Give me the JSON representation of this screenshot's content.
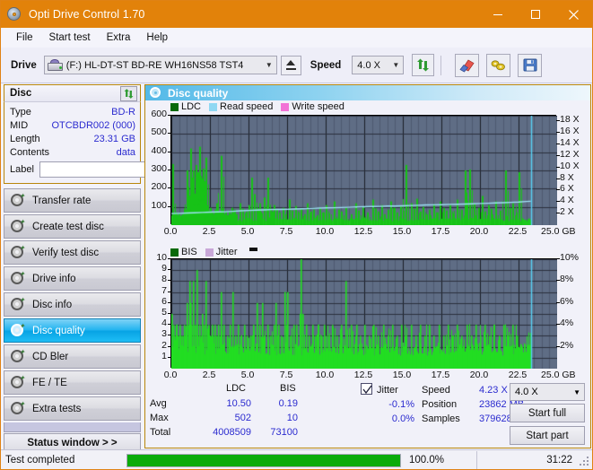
{
  "window": {
    "title": "Opti Drive Control 1.70",
    "icon": "disc-icon",
    "minimize": "─",
    "maximize": "□",
    "close": "✕"
  },
  "menubar": {
    "items": [
      "File",
      "Start test",
      "Extra",
      "Help"
    ]
  },
  "toolbar": {
    "drive_label": "Drive",
    "drive_value": "(F:)  HL-DT-ST BD-RE  WH16NS58 TST4",
    "eject_icon": "eject-icon",
    "speed_label": "Speed",
    "speed_value": "4.0 X",
    "refresh_icon": "refresh-icon",
    "erase_icon": "eraser-icon",
    "tools_icon": "tools-icon",
    "save_icon": "save-icon",
    "chevron": "⌄"
  },
  "disc_panel": {
    "title": "Disc",
    "refresh_icon": "refresh-icon",
    "rows": [
      {
        "label": "Type",
        "value": "BD-R"
      },
      {
        "label": "MID",
        "value": "OTCBDR002 (000)"
      },
      {
        "label": "Length",
        "value": "23.31 GB"
      },
      {
        "label": "Contents",
        "value": "data"
      }
    ],
    "label_field_label": "Label",
    "label_field_value": "",
    "label_button_icon": "disc-icon"
  },
  "nav": {
    "items": [
      {
        "label": "Transfer rate",
        "icon": "disc-icon",
        "selected": false
      },
      {
        "label": "Create test disc",
        "icon": "disc-icon",
        "selected": false
      },
      {
        "label": "Verify test disc",
        "icon": "disc-icon",
        "selected": false
      },
      {
        "label": "Drive info",
        "icon": "disc-icon",
        "selected": false
      },
      {
        "label": "Disc info",
        "icon": "disc-icon",
        "selected": false
      },
      {
        "label": "Disc quality",
        "icon": "disc-icon",
        "selected": true
      },
      {
        "label": "CD Bler",
        "icon": "disc-icon",
        "selected": false
      },
      {
        "label": "FE / TE",
        "icon": "disc-icon",
        "selected": false
      },
      {
        "label": "Extra tests",
        "icon": "disc-icon",
        "selected": false
      }
    ],
    "status_window_button": "Status window > >"
  },
  "content": {
    "header_title": "Disc quality",
    "header_icon": "disc-icon"
  },
  "stats": {
    "col_ldc": "LDC",
    "col_bis": "BIS",
    "rows": [
      {
        "label": "Avg",
        "ldc": "10.50",
        "bis": "0.19"
      },
      {
        "label": "Max",
        "ldc": "502",
        "bis": "10"
      },
      {
        "label": "Total",
        "ldc": "4008509",
        "bis": "73100"
      }
    ],
    "jitter_checkbox_label": "Jitter",
    "jitter_checked": true,
    "jitter_neg": "-0.1%",
    "jitter_pos": "0.0%",
    "speed_label": "Speed",
    "speed_value": "4.23 X",
    "position_label": "Position",
    "position_value": "23862 MB",
    "samples_label": "Samples",
    "samples_value": "379628",
    "speed_select_value": "4.0 X",
    "speed_select_chevron": "⌄",
    "start_full_button": "Start full",
    "start_part_button": "Start part"
  },
  "statusbar": {
    "text": "Test completed",
    "percent": "100.0%",
    "percent_value": 100,
    "time": "31:22"
  },
  "colors": {
    "title_bar": "#e2820a",
    "accent_border": "#b8860b",
    "plot_bg": "#5f6d85",
    "ldc_green": "#16a016",
    "bis_green": "#22dd22",
    "read_speed": "#7fd4f0",
    "write_speed": "#f07ad8",
    "jitter": "#c9a8d8",
    "selected_nav": "#0aa3e4",
    "progress_green": "#0aab0a",
    "value_blue": "#2b2bcf"
  },
  "chart_data": [
    {
      "type": "line",
      "id": "ldc-chart",
      "title": "Disc quality",
      "xlabel": "GB",
      "ylabel": "LDC",
      "legend": [
        {
          "name": "LDC",
          "color": "#0a6a0a"
        },
        {
          "name": "Read speed",
          "color": "#7fd4f0"
        },
        {
          "name": "Write speed",
          "color": "#f07ad8"
        }
      ],
      "legend_position": "top-left",
      "grid": true,
      "xlim": [
        0.0,
        25.0
      ],
      "xticks": [
        "0.0",
        "2.5",
        "5.0",
        "7.5",
        "10.0",
        "12.5",
        "15.0",
        "17.5",
        "20.0",
        "22.5",
        "25.0 GB"
      ],
      "ylim": [
        0,
        600
      ],
      "yticks": [
        100,
        200,
        300,
        400,
        500,
        600
      ],
      "y2lim": [
        0,
        19
      ],
      "y2ticks": [
        "2 X",
        "4 X",
        "6 X",
        "8 X",
        "10 X",
        "12 X",
        "14 X",
        "16 X",
        "18 X"
      ],
      "series": [
        {
          "name": "LDC",
          "color": "#16a016",
          "type": "impulse",
          "x": [
            0.05,
            0.12,
            0.2,
            0.3,
            0.38,
            0.45,
            0.55,
            0.62,
            0.7,
            0.8,
            0.9,
            1.0,
            1.05,
            1.12,
            1.2,
            1.3,
            1.35,
            1.42,
            1.5,
            1.55,
            1.6,
            1.68,
            1.72,
            1.8,
            1.85,
            1.9,
            1.95,
            2.0,
            2.05,
            2.1,
            2.15,
            2.2,
            2.3,
            2.35,
            2.4,
            2.5,
            2.6,
            2.7,
            2.8,
            2.9,
            3.0,
            3.1,
            3.2,
            3.3,
            3.4,
            3.5,
            3.6,
            3.7,
            3.8,
            3.9,
            3.95,
            4.05,
            4.2,
            4.4,
            4.6,
            4.8,
            5.0,
            5.2,
            5.35,
            5.5,
            5.6,
            5.7,
            5.8,
            6.0,
            6.2,
            6.4,
            6.5,
            6.6,
            6.8,
            7.0,
            7.2,
            7.4,
            7.6,
            7.8,
            8.0,
            8.2,
            8.4,
            8.6,
            8.8,
            9.0,
            9.2,
            9.4,
            9.6,
            9.8,
            10.0,
            10.2,
            10.5,
            10.8,
            11.0,
            11.3,
            11.6,
            11.9,
            12.1,
            12.4,
            12.7,
            13.0,
            13.2,
            13.4,
            13.6,
            13.8,
            14.0,
            14.2,
            14.4,
            14.6,
            14.8,
            15.0,
            15.2,
            15.5,
            15.7,
            15.9,
            16.1,
            16.3,
            16.5,
            16.7,
            17.0,
            17.2,
            17.4,
            17.6,
            17.8,
            18.0,
            18.2,
            18.5,
            18.8,
            19.0,
            19.3,
            19.6,
            19.9,
            20.1,
            20.3,
            20.5,
            20.7,
            21.0,
            21.3,
            21.6,
            21.9,
            22.1,
            22.3,
            22.5
          ],
          "y": [
            335,
            60,
            55,
            70,
            50,
            65,
            45,
            55,
            60,
            80,
            85,
            300,
            210,
            150,
            420,
            190,
            260,
            300,
            170,
            330,
            240,
            290,
            140,
            430,
            270,
            200,
            255,
            190,
            310,
            240,
            160,
            370,
            90,
            110,
            80,
            95,
            70,
            60,
            85,
            120,
            55,
            70,
            380,
            90,
            60,
            75,
            55,
            80,
            60,
            95,
            70,
            85,
            60,
            120,
            90,
            75,
            110,
            260,
            170,
            95,
            80,
            120,
            65,
            150,
            260,
            90,
            75,
            110,
            85,
            70,
            95,
            60,
            140,
            80,
            105,
            70,
            90,
            60,
            120,
            75,
            85,
            55,
            95,
            70,
            110,
            65,
            130,
            85,
            75,
            95,
            60,
            120,
            80,
            100,
            70,
            140,
            90,
            75,
            110,
            60,
            85,
            130,
            95,
            70,
            105,
            80,
            330,
            120,
            90,
            145,
            75,
            100,
            60,
            85,
            115,
            70,
            130,
            95,
            80,
            110,
            65,
            140,
            85,
            300,
            305,
            120,
            95,
            160,
            75,
            110,
            90,
            130,
            80,
            300,
            95,
            120,
            70,
            290,
            100
          ]
        },
        {
          "name": "Read speed",
          "color": "#8fdcf5",
          "type": "line",
          "x": [
            0.0,
            0.5,
            1.0,
            1.5,
            2.0,
            2.5,
            3.0,
            3.5,
            4.0,
            4.5,
            5.0,
            5.5,
            6.0,
            6.5,
            7.0,
            7.5,
            8.0,
            8.5,
            9.0,
            9.5,
            10.0,
            10.5,
            11.0,
            11.5,
            12.0,
            12.5,
            13.0,
            13.5,
            14.0,
            14.5,
            15.0,
            15.5,
            16.0,
            16.5,
            17.0,
            17.5,
            18.0,
            18.5,
            19.0,
            19.5,
            20.0,
            20.5,
            21.0,
            21.5,
            22.0,
            22.5,
            23.0,
            23.3
          ],
          "y_x": [
            2.0,
            2.05,
            2.1,
            2.15,
            2.2,
            2.25,
            2.3,
            2.32,
            2.4,
            2.5,
            2.55,
            2.6,
            2.65,
            2.7,
            2.72,
            2.75,
            2.8,
            2.85,
            2.9,
            2.95,
            3.0,
            3.02,
            3.05,
            3.1,
            3.15,
            3.2,
            3.22,
            3.25,
            3.3,
            3.32,
            3.35,
            3.4,
            3.45,
            3.5,
            3.52,
            3.55,
            3.6,
            3.62,
            3.65,
            3.7,
            3.75,
            3.8,
            3.85,
            3.9,
            3.95,
            4.0,
            4.1,
            4.15
          ]
        },
        {
          "name": "Write speed",
          "color": "#f07ad8",
          "type": "line",
          "x": [],
          "y": []
        }
      ],
      "cursor_x": 23.3
    },
    {
      "type": "line",
      "id": "bis-chart",
      "xlabel": "GB",
      "ylabel": "BIS",
      "legend": [
        {
          "name": "BIS",
          "color": "#0a6a0a"
        },
        {
          "name": "Jitter",
          "color": "#c9a8d8"
        }
      ],
      "legend_position": "top-left",
      "grid": true,
      "xlim": [
        0.0,
        25.0
      ],
      "xticks": [
        "0.0",
        "2.5",
        "5.0",
        "7.5",
        "10.0",
        "12.5",
        "15.0",
        "17.5",
        "20.0",
        "22.5",
        "25.0 GB"
      ],
      "ylim": [
        0,
        10
      ],
      "yticks": [
        1,
        2,
        3,
        4,
        5,
        6,
        7,
        8,
        9,
        10
      ],
      "y2lim": [
        0,
        10
      ],
      "y2ticks": [
        "2%",
        "4%",
        "6%",
        "8%",
        "10%"
      ],
      "series": [
        {
          "name": "BIS",
          "color": "#22dd22",
          "type": "impulse",
          "baseline": 2,
          "x": [
            0.02,
            0.1,
            0.2,
            0.3,
            0.4,
            0.5,
            0.6,
            0.7,
            0.8,
            0.9,
            1.0,
            1.1,
            1.15,
            1.2,
            1.3,
            1.4,
            1.5,
            1.6,
            1.65,
            1.7,
            1.8,
            1.9,
            2.0,
            2.1,
            2.2,
            2.3,
            2.4,
            2.5,
            2.6,
            2.7,
            2.8,
            2.9,
            3.0,
            3.2,
            3.4,
            3.6,
            3.8,
            3.95,
            4.1,
            4.3,
            4.5,
            4.7,
            4.9,
            5.1,
            5.3,
            5.5,
            5.7,
            5.85,
            6.0,
            6.2,
            6.4,
            6.6,
            6.75,
            6.9,
            7.1,
            7.3,
            7.45,
            7.5,
            7.7,
            7.9,
            8.1,
            8.3,
            8.4,
            8.5,
            8.7,
            8.9,
            9.1,
            9.3,
            9.5,
            9.7,
            9.9,
            10.1,
            10.4,
            10.7,
            11.0,
            11.3,
            11.6,
            11.9,
            12.0,
            12.2,
            12.5,
            12.8,
            13.1,
            13.4,
            13.7,
            14.0,
            14.3,
            14.6,
            14.9,
            15.2,
            15.5,
            15.8,
            16.1,
            16.4,
            16.7,
            17.0,
            17.3,
            17.6,
            17.9,
            18.2,
            18.5,
            18.8,
            19.1,
            19.4,
            19.7,
            20.0,
            20.3,
            20.6,
            20.9,
            21.2,
            21.5,
            21.8,
            22.1,
            22.4
          ],
          "y": [
            5,
            4,
            3,
            4,
            3,
            4,
            3,
            3,
            4,
            3,
            6,
            4,
            8,
            6,
            4,
            8,
            4,
            9,
            4,
            3,
            4,
            3,
            5,
            4,
            8,
            3,
            4,
            3,
            4,
            3,
            4,
            3,
            4,
            7,
            4,
            3,
            4,
            7,
            3,
            4,
            3,
            4,
            3,
            3,
            4,
            6,
            4,
            6,
            3,
            4,
            3,
            4,
            6,
            4,
            3,
            7,
            4,
            7,
            3,
            4,
            4,
            5,
            10,
            5,
            4,
            3,
            4,
            3,
            4,
            3,
            4,
            3,
            4,
            3,
            4,
            8,
            4,
            3,
            4,
            3,
            4,
            3,
            4,
            3,
            4,
            3,
            4,
            3,
            4,
            3,
            4,
            3,
            4,
            3,
            4,
            3,
            4,
            3,
            4,
            3,
            4,
            3,
            4,
            3,
            4,
            3,
            4,
            3,
            4,
            3,
            4,
            3,
            4,
            3
          ]
        },
        {
          "name": "Jitter",
          "color": "#c9a8d8",
          "type": "line",
          "x": [],
          "y": []
        }
      ],
      "cursor_x": 23.3
    }
  ]
}
